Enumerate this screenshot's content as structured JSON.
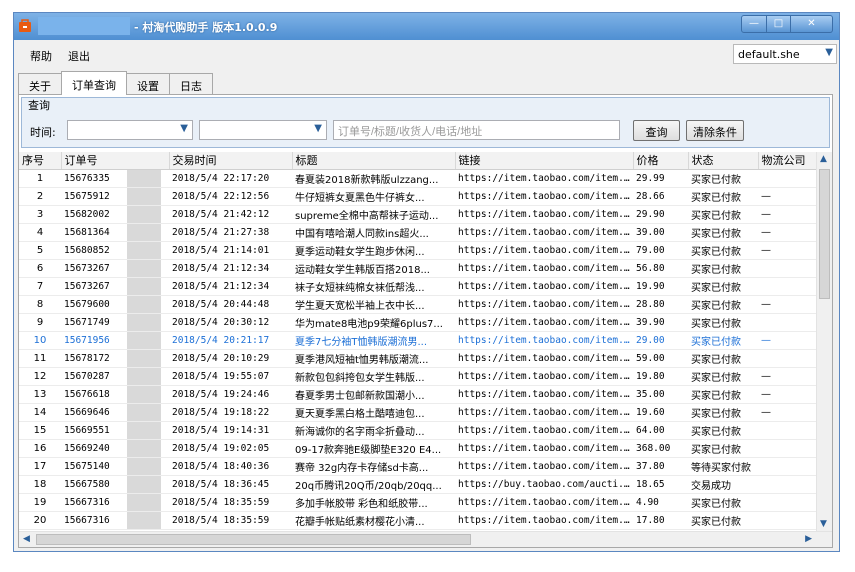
{
  "window": {
    "title": "- 村淘代购助手  版本1.0.0.9",
    "minimize_glyph": "—",
    "maximize_glyph": "□",
    "close_glyph": "✕"
  },
  "menu": {
    "help": "帮助",
    "exit": "退出",
    "profile_value": "default.she"
  },
  "tabs": [
    "关于",
    "订单查询",
    "设置",
    "日志"
  ],
  "query": {
    "legend": "查询",
    "time_label": "时间:",
    "search_placeholder": "订单号/标题/收货人/电话/地址",
    "query_button": "查询",
    "clear_button": "清除条件"
  },
  "table": {
    "columns": [
      "序号",
      "订单号",
      "交易时间",
      "标题",
      "链接",
      "价格",
      "状态",
      "物流公司"
    ],
    "rows": [
      {
        "seq": "1",
        "order": "15676335",
        "time": "2018/5/4 22:17:20",
        "title": "春夏装2018新款韩版ulzzang...",
        "link": "https://item.taobao.com/item...",
        "price": "29.99",
        "status": "买家已付款",
        "logistics": ""
      },
      {
        "seq": "2",
        "order": "15675912",
        "time": "2018/5/4 22:12:56",
        "title": "牛仔短裤女夏黑色牛仔裤女...",
        "link": "https://item.taobao.com/item...",
        "price": "28.66",
        "status": "买家已付款",
        "logistics": "—"
      },
      {
        "seq": "3",
        "order": "15682002",
        "time": "2018/5/4 21:42:12",
        "title": "supreme全棉中高帮袜子运动...",
        "link": "https://item.taobao.com/item...",
        "price": "29.90",
        "status": "买家已付款",
        "logistics": "—"
      },
      {
        "seq": "4",
        "order": "15681364",
        "time": "2018/5/4 21:27:38",
        "title": "中国有嘻哈潮人同款ins超火...",
        "link": "https://item.taobao.com/item...",
        "price": "39.00",
        "status": "买家已付款",
        "logistics": "—"
      },
      {
        "seq": "5",
        "order": "15680852",
        "time": "2018/5/4 21:14:01",
        "title": "夏季运动鞋女学生跑步休闲...",
        "link": "https://item.taobao.com/item...",
        "price": "79.00",
        "status": "买家已付款",
        "logistics": "—"
      },
      {
        "seq": "6",
        "order": "15673267",
        "time": "2018/5/4 21:12:34",
        "title": "运动鞋女学生韩版百搭2018...",
        "link": "https://item.taobao.com/item...",
        "price": "56.80",
        "status": "买家已付款",
        "logistics": ""
      },
      {
        "seq": "7",
        "order": "15673267",
        "time": "2018/5/4 21:12:34",
        "title": "袜子女短袜纯棉女袜低帮浅...",
        "link": "https://item.taobao.com/item...",
        "price": "19.90",
        "status": "买家已付款",
        "logistics": ""
      },
      {
        "seq": "8",
        "order": "15679600",
        "time": "2018/5/4 20:44:48",
        "title": "学生夏天宽松半袖上衣中长...",
        "link": "https://item.taobao.com/item...",
        "price": "28.80",
        "status": "买家已付款",
        "logistics": "—"
      },
      {
        "seq": "9",
        "order": "15671749",
        "time": "2018/5/4 20:30:12",
        "title": "华为mate8电池p9荣耀6plus7...",
        "link": "https://item.taobao.com/item...",
        "price": "39.90",
        "status": "买家已付款",
        "logistics": ""
      },
      {
        "seq": "10",
        "order": "15671956",
        "time": "2018/5/4 20:21:17",
        "title": "夏季7七分袖T恤韩版潮流男...",
        "link": "https://item.taobao.com/item...",
        "price": "29.00",
        "status": "买家已付款",
        "logistics": "—"
      },
      {
        "seq": "11",
        "order": "15678172",
        "time": "2018/5/4 20:10:29",
        "title": "夏季港风短袖t恤男韩版潮流...",
        "link": "https://item.taobao.com/item...",
        "price": "59.00",
        "status": "买家已付款",
        "logistics": ""
      },
      {
        "seq": "12",
        "order": "15670287",
        "time": "2018/5/4 19:55:07",
        "title": "新款包包斜挎包女学生韩版...",
        "link": "https://item.taobao.com/item...",
        "price": "19.80",
        "status": "买家已付款",
        "logistics": "—"
      },
      {
        "seq": "13",
        "order": "15676618",
        "time": "2018/5/4 19:24:46",
        "title": "春夏季男士包邮新款国潮小...",
        "link": "https://item.taobao.com/item...",
        "price": "35.00",
        "status": "买家已付款",
        "logistics": "—"
      },
      {
        "seq": "14",
        "order": "15669646",
        "time": "2018/5/4 19:18:22",
        "title": "夏天夏季黑白格土酷嘻迪包...",
        "link": "https://item.taobao.com/item...",
        "price": "19.60",
        "status": "买家已付款",
        "logistics": "—"
      },
      {
        "seq": "15",
        "order": "15669551",
        "time": "2018/5/4 19:14:31",
        "title": "新海诚你的名字雨伞折叠动...",
        "link": "https://item.taobao.com/item...",
        "price": "64.00",
        "status": "买家已付款",
        "logistics": ""
      },
      {
        "seq": "16",
        "order": "15669240",
        "time": "2018/5/4 19:02:05",
        "title": "09-17款奔驰E级脚垫E320 E4...",
        "link": "https://item.taobao.com/item...",
        "price": "368.00",
        "status": "买家已付款",
        "logistics": ""
      },
      {
        "seq": "17",
        "order": "15675140",
        "time": "2018/5/4 18:40:36",
        "title": "赛帝 32g内存卡存储sd卡高...",
        "link": "https://item.taobao.com/item...",
        "price": "37.80",
        "status": "等待买家付款",
        "logistics": ""
      },
      {
        "seq": "18",
        "order": "15667580",
        "time": "2018/5/4 18:36:45",
        "title": "20q币腾讯20Q币/20qb/20qq...",
        "link": "https://buy.taobao.com/aucti...",
        "price": "18.65",
        "status": "交易成功",
        "logistics": ""
      },
      {
        "seq": "19",
        "order": "15667316",
        "time": "2018/5/4 18:35:59",
        "title": "多加手帐胶带 彩色和纸胶带...",
        "link": "https://item.taobao.com/item...",
        "price": "4.90",
        "status": "买家已付款",
        "logistics": ""
      },
      {
        "seq": "20",
        "order": "15667316",
        "time": "2018/5/4 18:35:59",
        "title": "花瓣手帐贴纸素材樱花小清...",
        "link": "https://item.taobao.com/item...",
        "price": "17.80",
        "status": "买家已付款",
        "logistics": ""
      }
    ],
    "selected_row": 10
  },
  "colors": {
    "titlebar": "#4f8fd2",
    "selected_text": "#1c6fd6",
    "app_icon": "#e85b12"
  },
  "icons": {
    "app": "app-icon",
    "dropdown": "chevron-down-icon"
  }
}
